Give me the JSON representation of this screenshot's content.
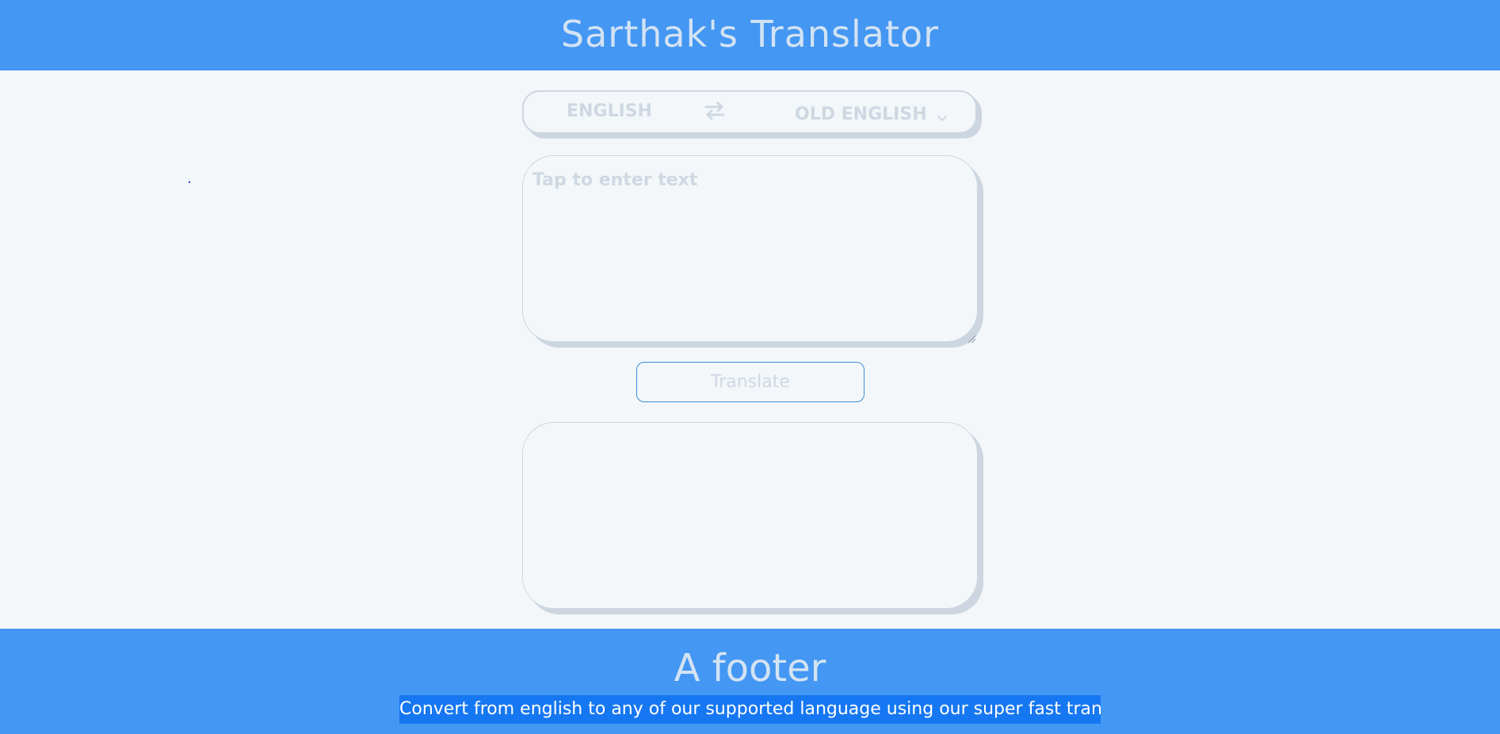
{
  "header": {
    "title": "Sarthak's Translator"
  },
  "language_bar": {
    "from_language": "ENGLISH",
    "to_language": "OLD ENGLISH",
    "swap_icon": "swap-arrows-icon",
    "dropdown_icon": "chevron-down-icon"
  },
  "input": {
    "placeholder": "Tap to enter text",
    "value": ""
  },
  "translate_button": {
    "label": "Translate"
  },
  "output": {
    "text": ""
  },
  "footer": {
    "title": "A footer",
    "description": "Convert from english to any of our supported language using our super fast translator."
  },
  "colors": {
    "primary": "#4497f3",
    "background": "#f3f7fa",
    "muted_text": "#cfd8e2",
    "border": "#cdd6e0",
    "selection": "#1677f2"
  }
}
